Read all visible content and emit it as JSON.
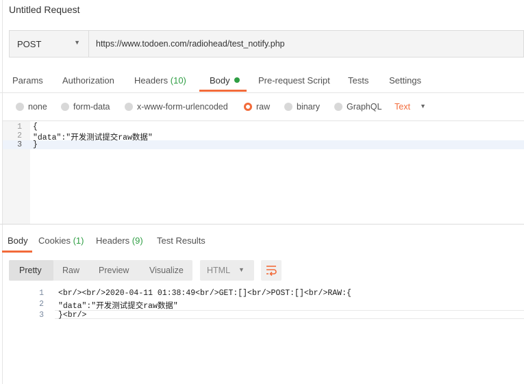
{
  "request": {
    "title": "Untitled Request",
    "method": "POST",
    "url": "https://www.todoen.com/radiohead/test_notify.php"
  },
  "request_tabs": {
    "params": "Params",
    "authorization": "Authorization",
    "headers": "Headers",
    "headers_count": "(10)",
    "body": "Body",
    "pre_request_script": "Pre-request Script",
    "tests": "Tests",
    "settings": "Settings"
  },
  "body_types": {
    "none": "none",
    "form_data": "form-data",
    "urlencoded": "x-www-form-urlencoded",
    "raw": "raw",
    "binary": "binary",
    "graphql": "GraphQL",
    "text_type": "Text",
    "selected": "raw"
  },
  "editor": {
    "line_numbers": [
      "1",
      "2",
      "3"
    ],
    "lines": [
      "{",
      "\"data\":\"开发测试提交raw数据\"",
      "}"
    ]
  },
  "response_tabs": {
    "body": "Body",
    "cookies": "Cookies",
    "cookies_count": "(1)",
    "headers": "Headers",
    "headers_count": "(9)",
    "test_results": "Test Results"
  },
  "response_toolbar": {
    "pretty": "Pretty",
    "raw": "Raw",
    "preview": "Preview",
    "visualize": "Visualize",
    "language": "HTML",
    "wrap_icon": "wrap-lines-icon"
  },
  "response": {
    "line_numbers": [
      "1",
      "2",
      "3"
    ],
    "lines": [
      "<br/><br/>2020-04-11 01:38:49<br/>GET:[]<br/>POST:[]<br/>RAW:{",
      "\"data\":\"开发测试提交raw数据\"",
      "}<br/>"
    ]
  },
  "colors": {
    "accent": "#f26b3a",
    "count_green": "#2f9e44"
  }
}
